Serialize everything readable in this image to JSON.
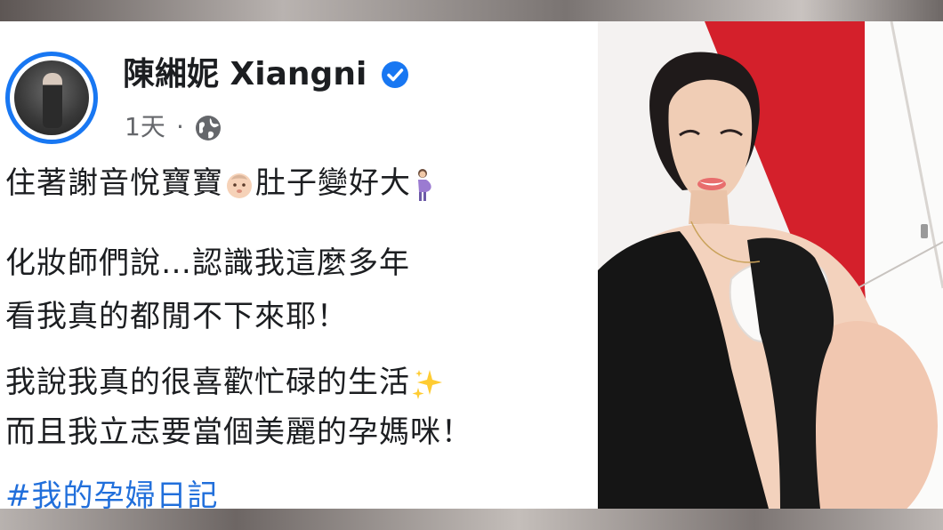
{
  "post": {
    "author": "陳緗妮 Xiangni",
    "time": "1天",
    "dot": "·",
    "lines": [
      "住著謝音悅寶寶",
      "肚子變好大",
      "化妝師們說…認識我這麼多年",
      "看我真的都閒不下來耶！",
      "我說我真的很喜歡忙碌的生活",
      "而且我立志要當個美麗的孕媽咪！"
    ],
    "hashtag": "#我的孕婦日記"
  },
  "icons": [
    "verified-badge-icon",
    "globe-icon",
    "baby-emoji-icon",
    "pregnant-woman-emoji-icon",
    "sparkles-emoji-icon"
  ],
  "colors": {
    "verified": "#1877f2",
    "hashtag": "#216fdb",
    "meta": "#65676b",
    "text": "#1c1e21",
    "wall_red": "#d4202b"
  }
}
